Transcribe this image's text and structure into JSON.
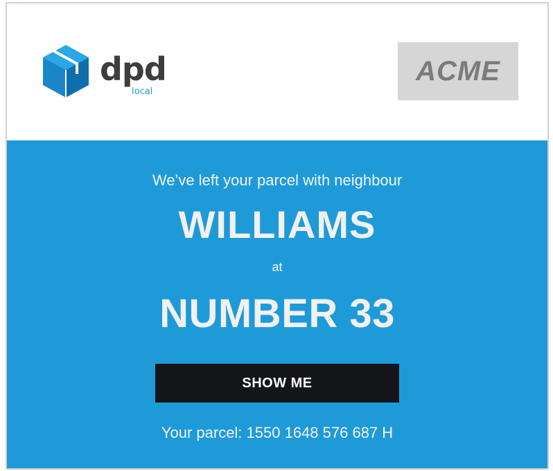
{
  "header": {
    "dpd_logo": {
      "word": "dpd",
      "sub": "local",
      "brand_color": "#1b9ad8",
      "text_color": "#3d3d3f"
    },
    "acme_logo": {
      "text": "ACME",
      "background": "#d6d6d6",
      "color": "#7b7b7b"
    }
  },
  "notice": {
    "background": "#1f9ad9",
    "intro": "We’ve left your parcel with neighbour",
    "neighbour_name": "WILLIAMS",
    "at": "at",
    "address": "NUMBER 33",
    "button_label": "SHOW ME",
    "button_color": "#141519",
    "parcel_line": "Your parcel: 1550 1648 576 687 H"
  }
}
